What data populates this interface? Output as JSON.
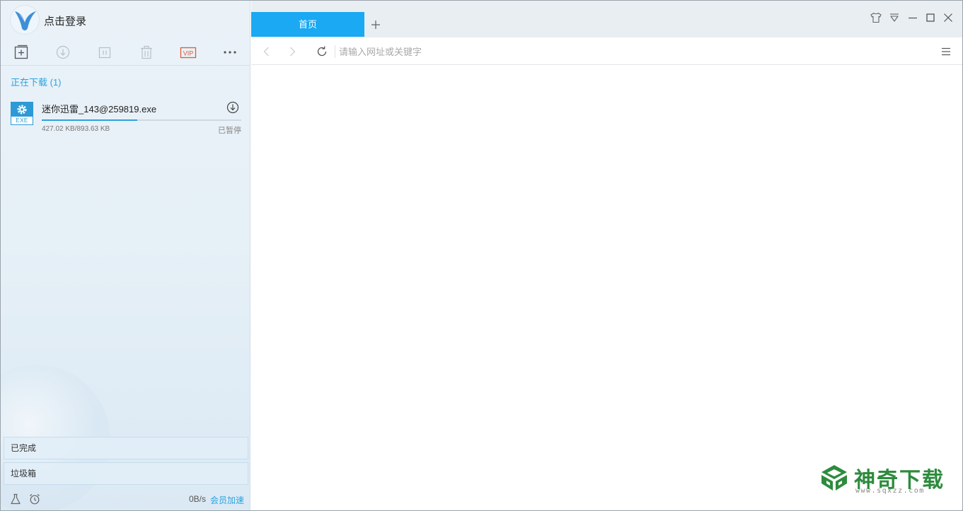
{
  "header": {
    "login_text": "点击登录"
  },
  "toolbar": {
    "items": [
      {
        "icon": "new-task-icon"
      },
      {
        "icon": "start-download-icon"
      },
      {
        "icon": "pause-icon"
      },
      {
        "icon": "delete-icon"
      },
      {
        "icon": "vip-icon",
        "label": "VIP",
        "color": "#e05a3a"
      },
      {
        "icon": "more-icon"
      }
    ]
  },
  "downloading": {
    "title": "正在下载 (1)",
    "tasks": [
      {
        "file_type": "EXE",
        "name": "迷你迅雷_143@259819.exe",
        "size": "427.02 KB/893.63 KB",
        "progress": 0.478,
        "status": "已暂停"
      }
    ]
  },
  "nav": {
    "completed": "已完成",
    "trash": "垃圾箱"
  },
  "footer": {
    "speed": "0B/s",
    "vip_accelerate": "会员加速"
  },
  "browser": {
    "tabs": [
      {
        "label": "首页"
      }
    ],
    "url_placeholder": "请输入网址或关键字",
    "accent_color": "#1aa9f2"
  },
  "watermark": {
    "title": "神奇下载",
    "url": "www.sqxzz.com"
  }
}
